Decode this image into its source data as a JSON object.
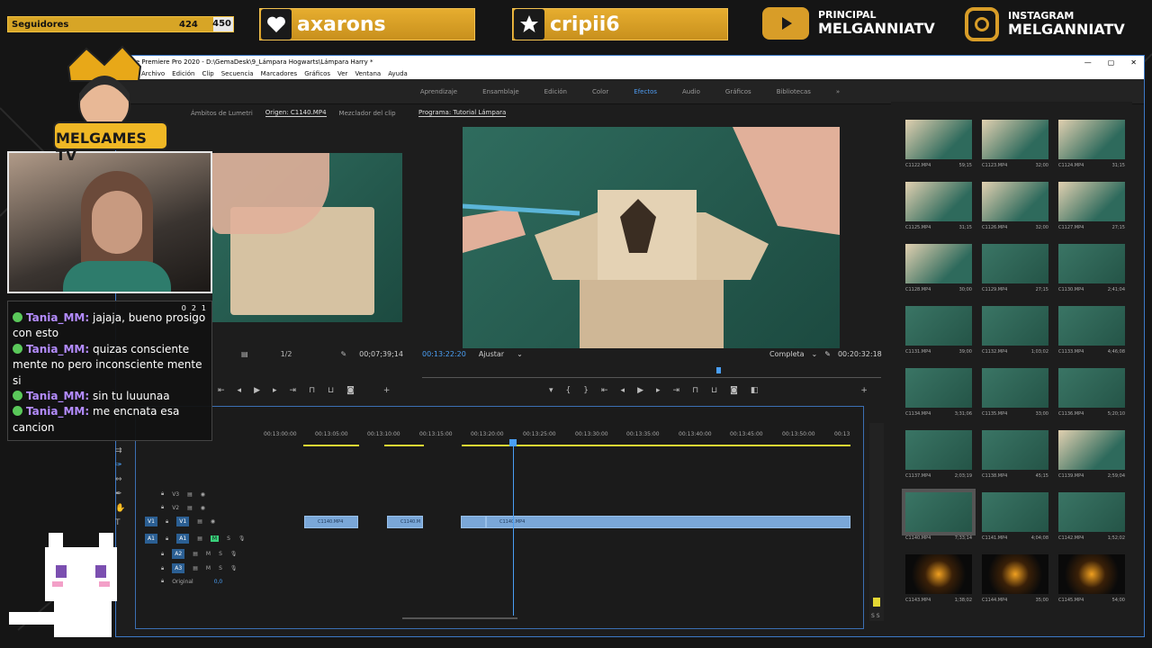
{
  "overlay": {
    "followers_label": "Seguidores",
    "followers_count": "424",
    "followers_goal": "450",
    "social1": "axarons",
    "social2": "cripii6",
    "youtube_label": "PRINCIPAL",
    "youtube_name": "MELGANNIATV",
    "instagram_label": "INSTAGRAM",
    "instagram_name": "MELGANNIATV",
    "logo": "MELGAMES TV"
  },
  "app": {
    "title": "Adobe Premiere Pro 2020 - D:\\GemaDesk\\9_Lámpara Hogwarts\\Lámpara Harry *",
    "menu": [
      "Archivo",
      "Edición",
      "Clip",
      "Secuencia",
      "Marcadores",
      "Gráficos",
      "Ver",
      "Ventana",
      "Ayuda"
    ],
    "workspaces": [
      "Aprendizaje",
      "Ensamblaje",
      "Edición",
      "Color",
      "Efectos",
      "Audio",
      "Gráficos",
      "Bibliotecas"
    ],
    "active_workspace": "Efectos"
  },
  "source": {
    "tabs": [
      "Ámbitos de Lumetri",
      "Origen: C1140.MP4",
      "Mezclador del clip"
    ],
    "zoom": "1/2",
    "timecode": "00;07;39;14"
  },
  "program": {
    "title": "Programa: Tutorial Lámpara",
    "timecode": "00:13:22:20",
    "fit": "Ajustar",
    "quality": "Completa",
    "duration": "00:20:32:18"
  },
  "timeline": {
    "ruler": [
      "00:13:00:00",
      "00:13:05:00",
      "00:13:10:00",
      "00:13:15:00",
      "00:13:20:00",
      "00:13:25:00",
      "00:13:30:00",
      "00:13:35:00",
      "00:13:40:00",
      "00:13:45:00",
      "00:13:50:00",
      "00:13"
    ],
    "tracks": [
      "V3",
      "V2",
      "V1",
      "A1",
      "A2",
      "A3"
    ],
    "original_label": "Original",
    "original_value": "0,0",
    "clip_name": "C1140.MP4",
    "clip_short": "C1140.M",
    "meter_labels": "S S"
  },
  "bin": [
    [
      "C1122.MP4",
      "59;15"
    ],
    [
      "C1123.MP4",
      "32;00"
    ],
    [
      "C1124.MP4",
      "31;15"
    ],
    [
      "C1125.MP4",
      "31;15"
    ],
    [
      "C1126.MP4",
      "32;00"
    ],
    [
      "C1127.MP4",
      "27;15"
    ],
    [
      "C1128.MP4",
      "30;00"
    ],
    [
      "C1129.MP4",
      "27;15"
    ],
    [
      "C1130.MP4",
      "2;41;04"
    ],
    [
      "C1131.MP4",
      "39;00"
    ],
    [
      "C1132.MP4",
      "1;03;02"
    ],
    [
      "C1133.MP4",
      "4;46;08"
    ],
    [
      "C1134.MP4",
      "3;31;06"
    ],
    [
      "C1135.MP4",
      "33;00"
    ],
    [
      "C1136.MP4",
      "5;20;10"
    ],
    [
      "C1137.MP4",
      "2;03;19"
    ],
    [
      "C1138.MP4",
      "45;15"
    ],
    [
      "C1139.MP4",
      "2;59;04"
    ],
    [
      "C1140.MP4",
      "7;33;14"
    ],
    [
      "C1141.MP4",
      "4;04;08"
    ],
    [
      "C1142.MP4",
      "1;52;02"
    ],
    [
      "C1143.MP4",
      "1;38;02"
    ],
    [
      "C1144.MP4",
      "35;00"
    ],
    [
      "C1145.MP4",
      "54;00"
    ]
  ],
  "chat": {
    "counts": [
      "0",
      "2",
      "1"
    ],
    "messages": [
      {
        "user": "Tania_MM:",
        "text": "jajaja, bueno prosigo con esto"
      },
      {
        "user": "Tania_MM:",
        "text": "quizas consciente mente no pero inconsciente mente si"
      },
      {
        "user": "Tania_MM:",
        "text": "sin tu luuunaa"
      },
      {
        "user": "Tania_MM:",
        "text": "me encnata esa cancion"
      }
    ]
  }
}
